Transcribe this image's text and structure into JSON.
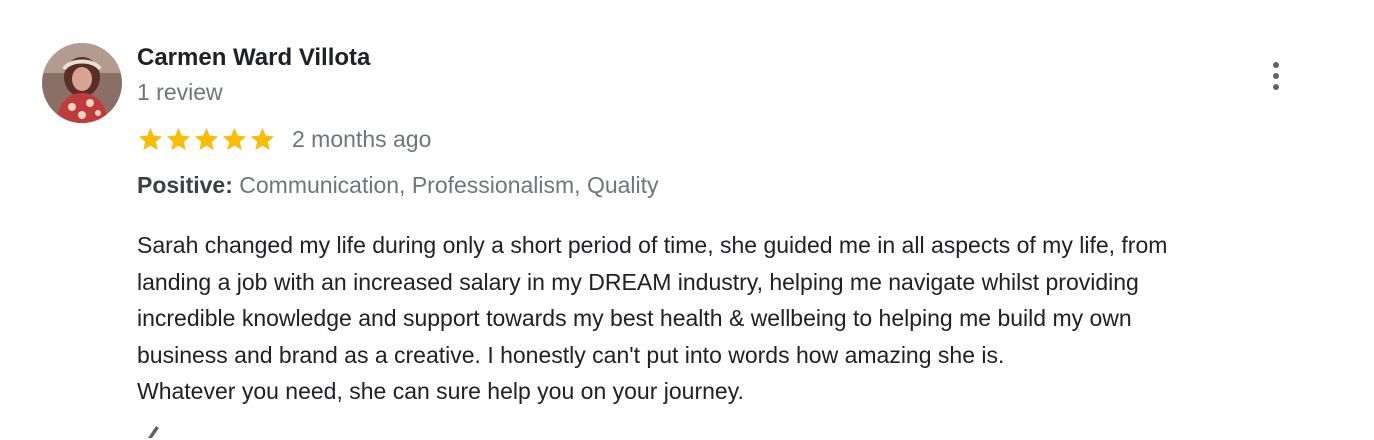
{
  "review": {
    "reviewer_name": "Carmen Ward Villota",
    "review_count": "1 review",
    "rating": 5,
    "rating_max": 5,
    "date": "2 months ago",
    "attributes": {
      "label": "Positive:",
      "values": "Communication, Professionalism, Quality"
    },
    "text_lines": [
      "Sarah changed my life during only a short period of time, she guided me in all aspects of my life, from",
      "landing a job with an increased salary in my DREAM industry, helping me navigate whilst providing",
      "incredible knowledge and support towards my best health & wellbeing to helping me build my own",
      "business and brand as a creative. I honestly can't put into words how amazing she is.",
      "Whatever you need, she can sure help you on your journey."
    ]
  },
  "icons": {
    "more": "more-vert-icon",
    "star": "star-icon",
    "thumb": "thumb-up-icon"
  },
  "colors": {
    "star": "#fbbc04",
    "name": "#202124",
    "secondary": "#70757a",
    "body": "#202124"
  }
}
